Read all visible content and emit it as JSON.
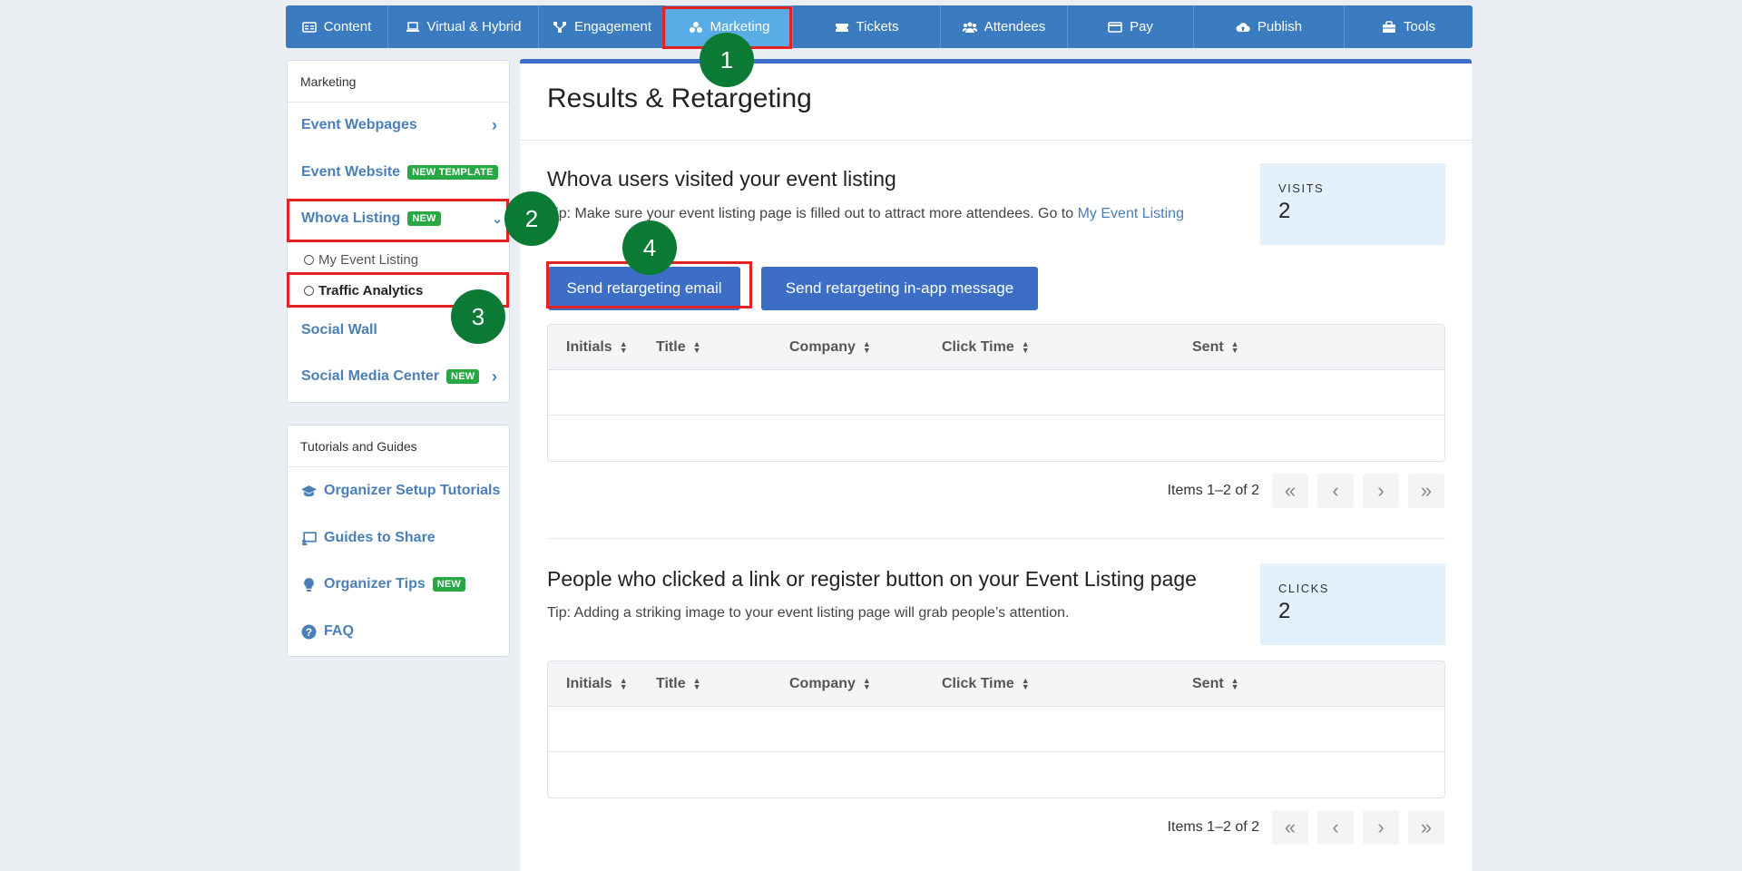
{
  "nav": {
    "items": [
      {
        "label": "Content",
        "icon": "content-icon"
      },
      {
        "label": "Virtual & Hybrid",
        "icon": "laptop-icon"
      },
      {
        "label": "Engagement",
        "icon": "network-icon"
      },
      {
        "label": "Marketing",
        "icon": "users-group-icon",
        "active": true
      },
      {
        "label": "Tickets",
        "icon": "ticket-icon"
      },
      {
        "label": "Attendees",
        "icon": "attendees-icon"
      },
      {
        "label": "Pay",
        "icon": "card-icon"
      },
      {
        "label": "Publish",
        "icon": "cloud-upload-icon"
      },
      {
        "label": "Tools",
        "icon": "toolbox-icon"
      }
    ]
  },
  "sidebar": {
    "title": "Marketing",
    "items": {
      "event_webpages": "Event Webpages",
      "event_website": "Event Website",
      "event_website_badge": "NEW TEMPLATE",
      "whova_listing": "Whova Listing",
      "whova_listing_badge": "NEW",
      "my_event_listing": "My Event Listing",
      "traffic_analytics": "Traffic Analytics",
      "social_wall": "Social Wall",
      "social_media_center": "Social Media Center",
      "social_media_center_badge": "NEW"
    }
  },
  "tutorials": {
    "title": "Tutorials and Guides",
    "setup": "Organizer Setup Tutorials",
    "guides": "Guides to Share",
    "tips": "Organizer Tips",
    "tips_badge": "NEW",
    "faq": "FAQ"
  },
  "markers": [
    "1",
    "2",
    "3",
    "4"
  ],
  "main": {
    "title": "Results & Retargeting",
    "visits": {
      "title": "Whova users visited your event listing",
      "tip_prefix": "Tip: Make sure your event listing page is filled out to attract more attendees. Go to ",
      "tip_link": "My Event Listing",
      "stat_label": "VISITS",
      "stat_value": "2",
      "btn_email": "Send retargeting email",
      "btn_inapp": "Send retargeting in-app message"
    },
    "clicks": {
      "title": "People who clicked a link or register button on your Event Listing page",
      "tip": "Tip: Adding a striking image to your event listing page will grab people’s attention.",
      "stat_label": "CLICKS",
      "stat_value": "2"
    },
    "columns": [
      "Initials",
      "Title",
      "Company",
      "Click Time",
      "Sent"
    ],
    "pager_label": "Items 1–2 of 2"
  },
  "colors": {
    "nav": "#3b7bbf",
    "nav_active": "#5aace6",
    "primary": "#3b6ec4",
    "badge": "#28a745",
    "marker": "#0a7a35",
    "highlight": "#e32222"
  }
}
